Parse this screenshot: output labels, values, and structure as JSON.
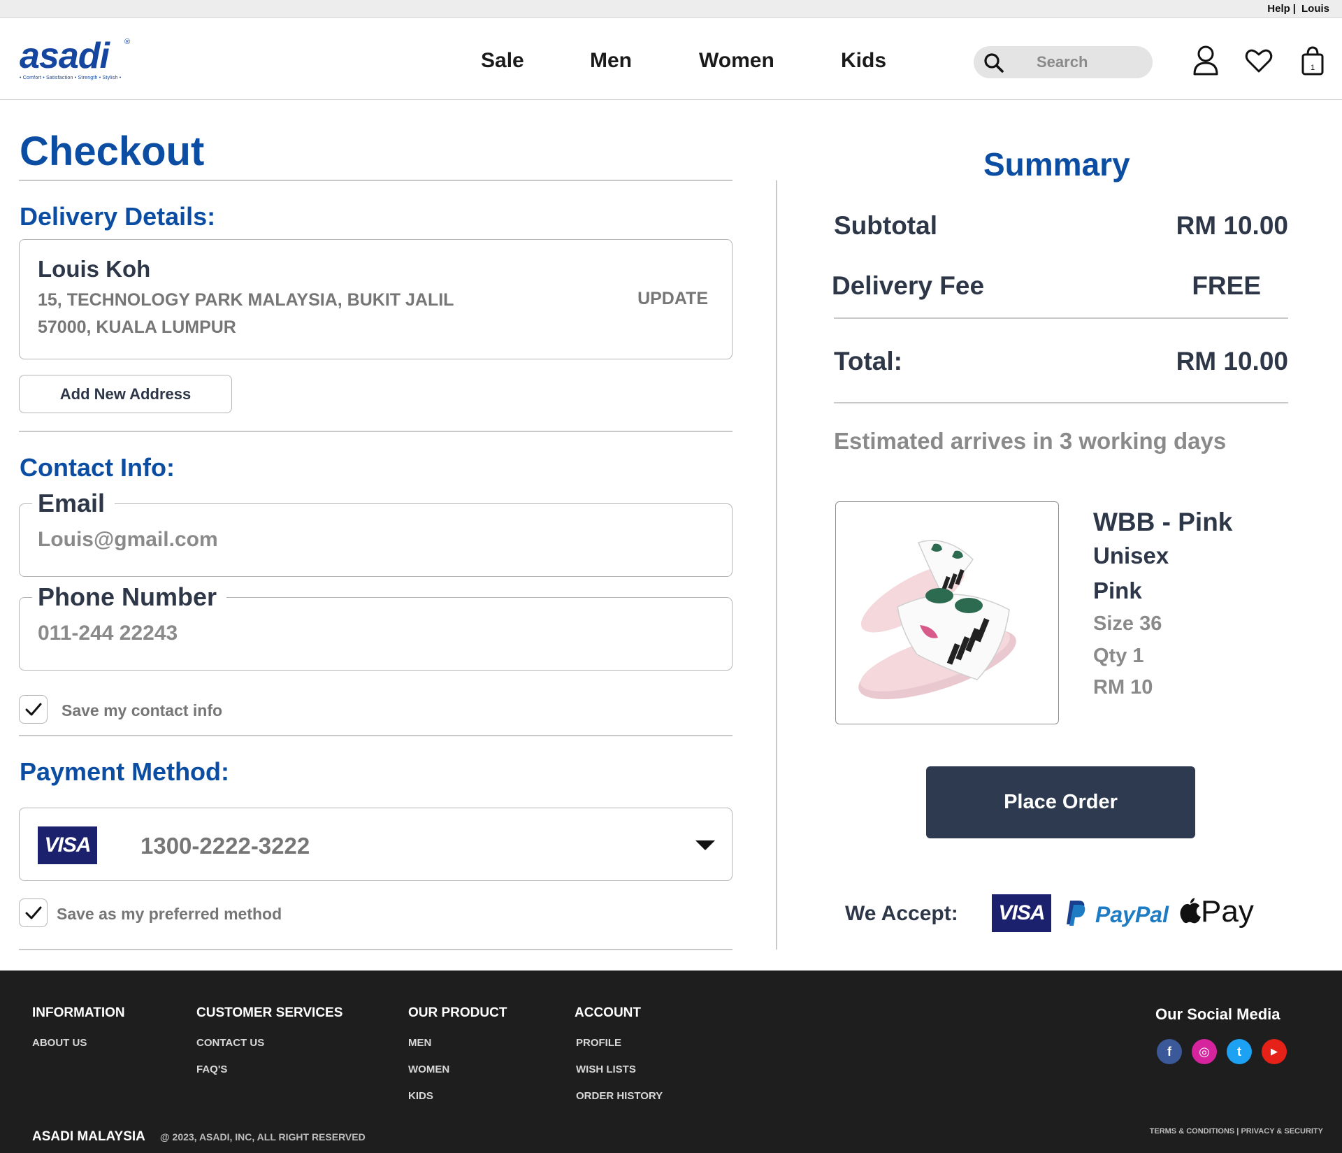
{
  "topbar": {
    "help": "Help",
    "user": "Louis"
  },
  "brand": {
    "logo": "asadi",
    "tagline": "• Comfort • Satisfaction • Strength • Stylish •",
    "color": "#1446a0"
  },
  "nav": [
    "Sale",
    "Men",
    "Women",
    "Kids"
  ],
  "search": {
    "placeholder": "Search"
  },
  "icons": [
    "search-icon",
    "account-icon",
    "heart-icon",
    "shopping-bag-icon"
  ],
  "page": {
    "title": "Checkout"
  },
  "delivery": {
    "heading": "Delivery Details:",
    "name": "Louis Koh",
    "line1": "15, TECHNOLOGY PARK MALAYSIA, BUKIT JALIL",
    "line2": "57000, KUALA LUMPUR",
    "update": "UPDATE",
    "add_new": "Add New Address"
  },
  "contact": {
    "heading": "Contact Info:",
    "email_label": "Email",
    "email_value": "Louis@gmail.com",
    "phone_label": "Phone Number",
    "phone_value": "011-244 22243",
    "save_label": "Save my contact info",
    "save_checked": true
  },
  "payment": {
    "heading": "Payment Method:",
    "card_brand": "VISA",
    "card_number": "1300-2222-3222",
    "save_label": "Save as my preferred method",
    "save_checked": true
  },
  "summary": {
    "heading": "Summary",
    "subtotal_label": "Subtotal",
    "subtotal_value": "RM 10.00",
    "delivery_label": "Delivery Fee",
    "delivery_value": "FREE",
    "total_label": "Total:",
    "total_value": "RM 10.00",
    "eta": "Estimated arrives in 3 working days",
    "product": {
      "name": "WBB - Pink",
      "gender": "Unisex",
      "color": "Pink",
      "size": "Size 36",
      "qty": "Qty 1",
      "price": "RM 10"
    },
    "place_order": "Place Order",
    "accept_label": "We Accept:",
    "accept_methods": [
      "VISA",
      "PayPal",
      "Pay"
    ]
  },
  "footer": {
    "columns": [
      {
        "title": "INFORMATION",
        "links": [
          "ABOUT US"
        ]
      },
      {
        "title": "CUSTOMER SERVICES",
        "links": [
          "CONTACT US",
          "FAQ'S"
        ]
      },
      {
        "title": "OUR PRODUCT",
        "links": [
          "MEN",
          "WOMEN",
          "KIDS"
        ]
      },
      {
        "title": "ACCOUNT",
        "links": [
          "PROFILE",
          "WISH LISTS",
          "ORDER HISTORY"
        ]
      }
    ],
    "social_title": "Our Social Media",
    "social": [
      {
        "name": "facebook-icon",
        "glyph": "f",
        "color": "#3b5998"
      },
      {
        "name": "instagram-icon",
        "glyph": "◎",
        "color": "#d6249f"
      },
      {
        "name": "twitter-icon",
        "glyph": "t",
        "color": "#1da1f2"
      },
      {
        "name": "youtube-icon",
        "glyph": "▶",
        "color": "#e62117"
      }
    ],
    "brand": "ASADI MALAYSIA",
    "copyright": "@ 2023, ASADI, INC, ALL RIGHT RESERVED",
    "terms": "TERMS & CONDITIONS | PRIVACY & SECURITY"
  },
  "colors": {
    "accent": "#0b4da2",
    "dark": "#2e3a4f",
    "text": "#2d3748",
    "muted": "#767676"
  }
}
